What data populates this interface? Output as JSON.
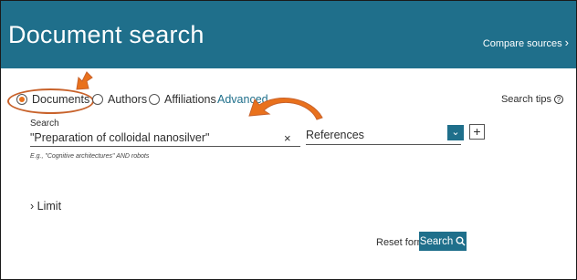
{
  "header": {
    "title": "Document search",
    "compare_label": "Compare sources"
  },
  "search_type": {
    "options": [
      {
        "label": "Documents",
        "selected": true
      },
      {
        "label": "Authors",
        "selected": false
      },
      {
        "label": "Affiliations",
        "selected": false
      }
    ],
    "advanced_label": "Advanced"
  },
  "search_tips_label": "Search tips",
  "search": {
    "label": "Search",
    "value": "\"Preparation of colloidal nanosilver\"",
    "example": "E.g., \"Cognitive architectures\" AND robots",
    "clear_icon": "×"
  },
  "field": {
    "selected": "References"
  },
  "add_label": "+",
  "limit_label": "Limit",
  "actions": {
    "reset_label": "Reset form",
    "search_label": "Search"
  },
  "colors": {
    "header_bg": "#1f6f8b",
    "accent_orange": "#e9711c",
    "annotation": "#c8622b"
  },
  "icons": {
    "help": "help-icon",
    "dropdown": "chevron-down-icon",
    "search": "magnifier-icon",
    "limit": "chevron-right-icon"
  }
}
